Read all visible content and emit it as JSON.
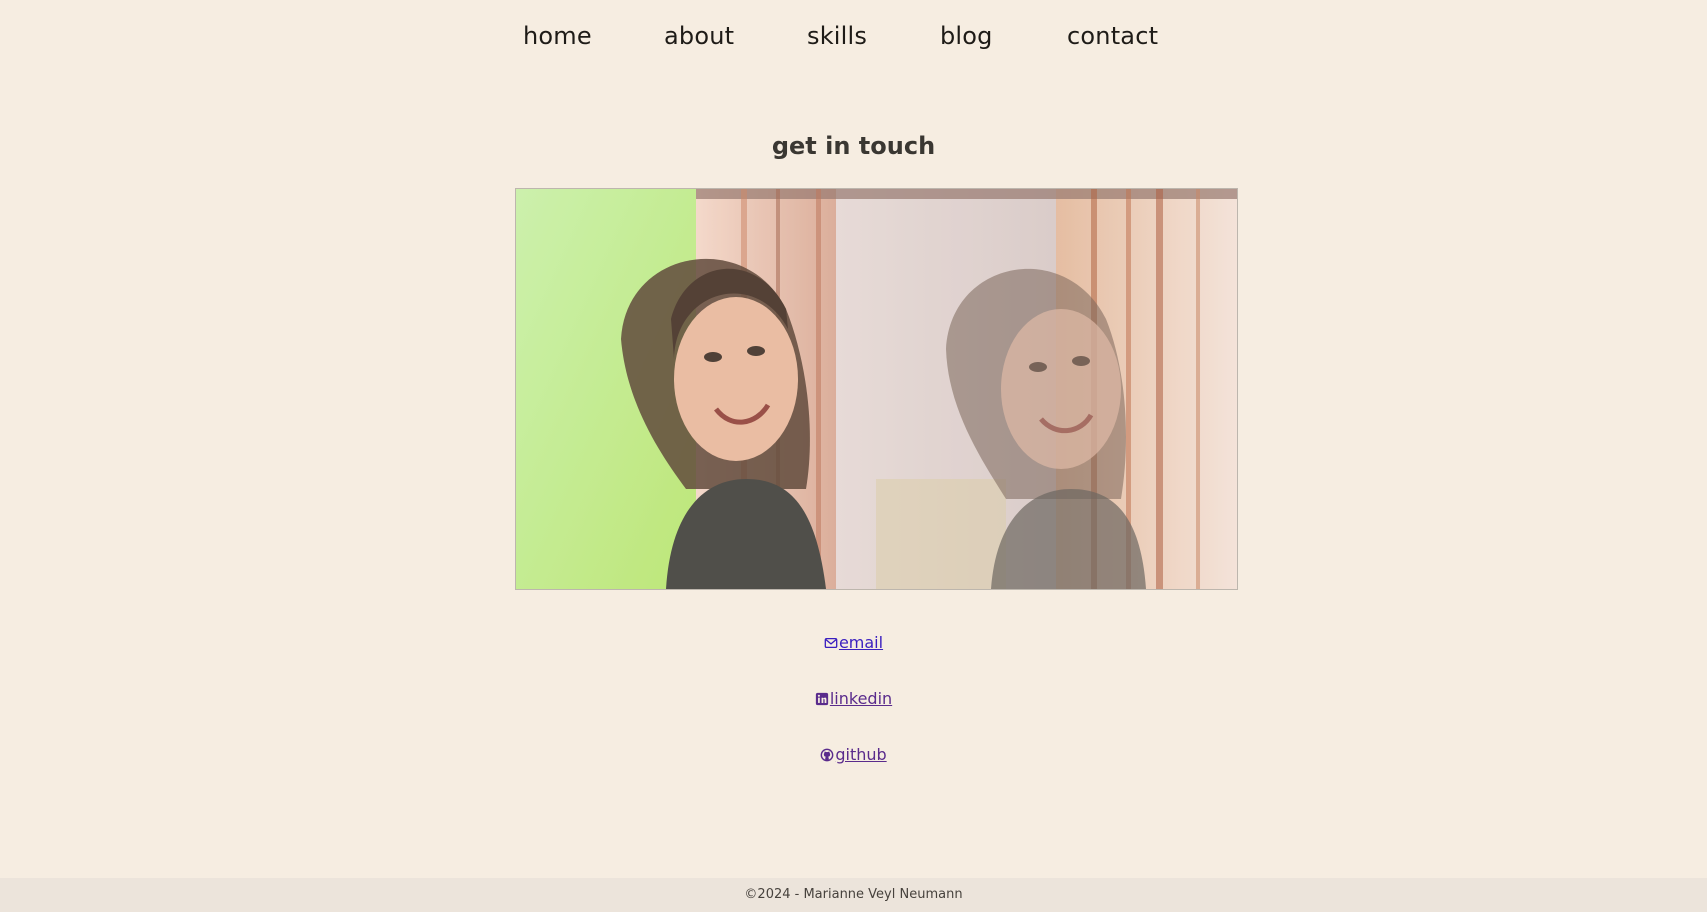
{
  "nav": {
    "items": [
      {
        "label": "home"
      },
      {
        "label": "about"
      },
      {
        "label": "skills"
      },
      {
        "label": "blog"
      },
      {
        "label": "contact"
      }
    ]
  },
  "main": {
    "title": "get in touch",
    "photo_icon": "portrait-photo"
  },
  "links": [
    {
      "label": "email",
      "icon": "mail-icon"
    },
    {
      "label": "linkedin",
      "icon": "linkedin-icon"
    },
    {
      "label": "github",
      "icon": "github-icon"
    }
  ],
  "footer": {
    "text": "©2024 - Marianne Veyl Neumann"
  },
  "colors": {
    "background": "#f6ede1",
    "link": "#3a1fbf",
    "visited_link": "#5a2b8c",
    "footer_bg": "#ece4db"
  }
}
